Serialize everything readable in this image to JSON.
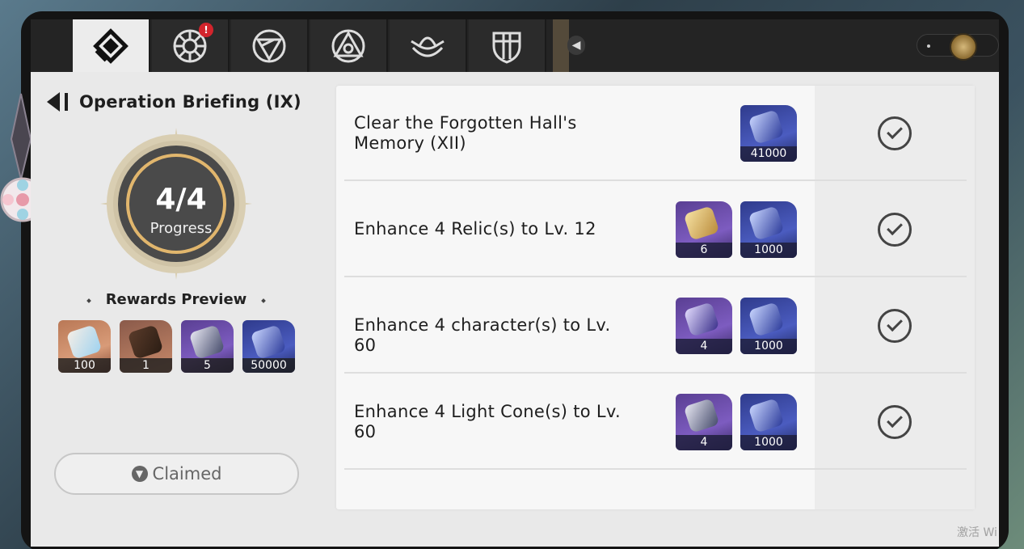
{
  "tabs": [
    {
      "icon": "daily-training-icon",
      "active": true,
      "alert": false
    },
    {
      "icon": "achievement-wheel-icon",
      "active": false,
      "alert": true
    },
    {
      "icon": "triangle-emblem-icon",
      "active": false,
      "alert": false
    },
    {
      "icon": "trinity-emblem-icon",
      "active": false,
      "alert": false
    },
    {
      "icon": "lotus-emblem-icon",
      "active": false,
      "alert": false
    },
    {
      "icon": "shield-emblem-icon",
      "active": false,
      "alert": false
    }
  ],
  "alert_badge": "!",
  "header": {
    "title": "Operation Briefing (IX)"
  },
  "progress": {
    "count": "4/4",
    "label": "Progress",
    "fraction": 1.0
  },
  "rewards_preview": {
    "title": "Rewards Preview",
    "items": [
      {
        "icon": "crystal-icon",
        "qty": "100"
      },
      {
        "icon": "wooden-chest-icon",
        "qty": "1"
      },
      {
        "icon": "lightcone-material-icon",
        "qty": "5"
      },
      {
        "icon": "credit-icon",
        "qty": "50000"
      }
    ]
  },
  "claimed_button": {
    "label": "Claimed"
  },
  "tasks": [
    {
      "text": "Clear the Forgotten Hall's Memory (XII)",
      "rewards": [
        {
          "icon": "credit-icon",
          "qty": "41000"
        }
      ],
      "completed": true
    },
    {
      "text": "Enhance 4 Relic(s) to Lv. 12",
      "rewards": [
        {
          "icon": "relic-material-icon",
          "qty": "6"
        },
        {
          "icon": "credit-icon",
          "qty": "1000"
        }
      ],
      "completed": true
    },
    {
      "text": "Enhance 4 character(s) to Lv. 60",
      "rewards": [
        {
          "icon": "exp-material-icon",
          "qty": "4"
        },
        {
          "icon": "credit-icon",
          "qty": "1000"
        }
      ],
      "completed": true
    },
    {
      "text": "Enhance 4 Light Cone(s) to Lv. 60",
      "rewards": [
        {
          "icon": "lightcone-material-icon",
          "qty": "4"
        },
        {
          "icon": "credit-icon",
          "qty": "1000"
        }
      ],
      "completed": true
    }
  ],
  "watermark": "激活 Wi",
  "colors": {
    "accent_gold": "#e1b66d",
    "tab_active": "#ececec",
    "tab_inactive": "#2b2b2b",
    "alert": "#d3242c"
  }
}
